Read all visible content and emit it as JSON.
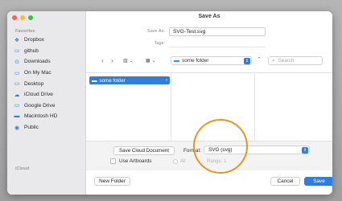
{
  "window": {
    "title": "Save As"
  },
  "sidebar": {
    "favorites_heading": "Favorites",
    "icloud_heading": "iCloud",
    "items": [
      {
        "label": "Dropbox",
        "icon": "dropbox-icon",
        "glyph": "❖"
      },
      {
        "label": "github",
        "icon": "folder-icon",
        "glyph": "▭"
      },
      {
        "label": "Downloads",
        "icon": "downloads-icon",
        "glyph": "⊙"
      },
      {
        "label": "On My Mac",
        "icon": "laptop-icon",
        "glyph": "▭"
      },
      {
        "label": "Desktop",
        "icon": "desktop-icon",
        "glyph": "▭"
      },
      {
        "label": "iCloud Drive",
        "icon": "cloud-icon",
        "glyph": "☁"
      },
      {
        "label": "Google Drive",
        "icon": "folder-icon",
        "glyph": "▭"
      },
      {
        "label": "Macintosh HD",
        "icon": "disk-icon",
        "glyph": "▬"
      },
      {
        "label": "Public",
        "icon": "public-icon",
        "glyph": "◉"
      }
    ]
  },
  "form": {
    "save_as_label": "Save As:",
    "save_as_value": "SVG-Test.svg",
    "tags_label": "Tags:"
  },
  "toolbar": {
    "back": "‹",
    "forward": "›",
    "location": "some folder",
    "search_placeholder": "Search"
  },
  "browser": {
    "selected_folder": "some folder"
  },
  "options": {
    "cloud_button": "Save Cloud Document",
    "format_label": "Format:",
    "format_value": "SVG (svg)",
    "use_artboards": "Use Artboards",
    "all_label": "All",
    "range_label": "Range: 1"
  },
  "footer": {
    "new_folder": "New Folder",
    "cancel": "Cancel",
    "save": "Save"
  },
  "colors": {
    "accent": "#2f7ddc",
    "highlight_ring": "#e4951d"
  }
}
